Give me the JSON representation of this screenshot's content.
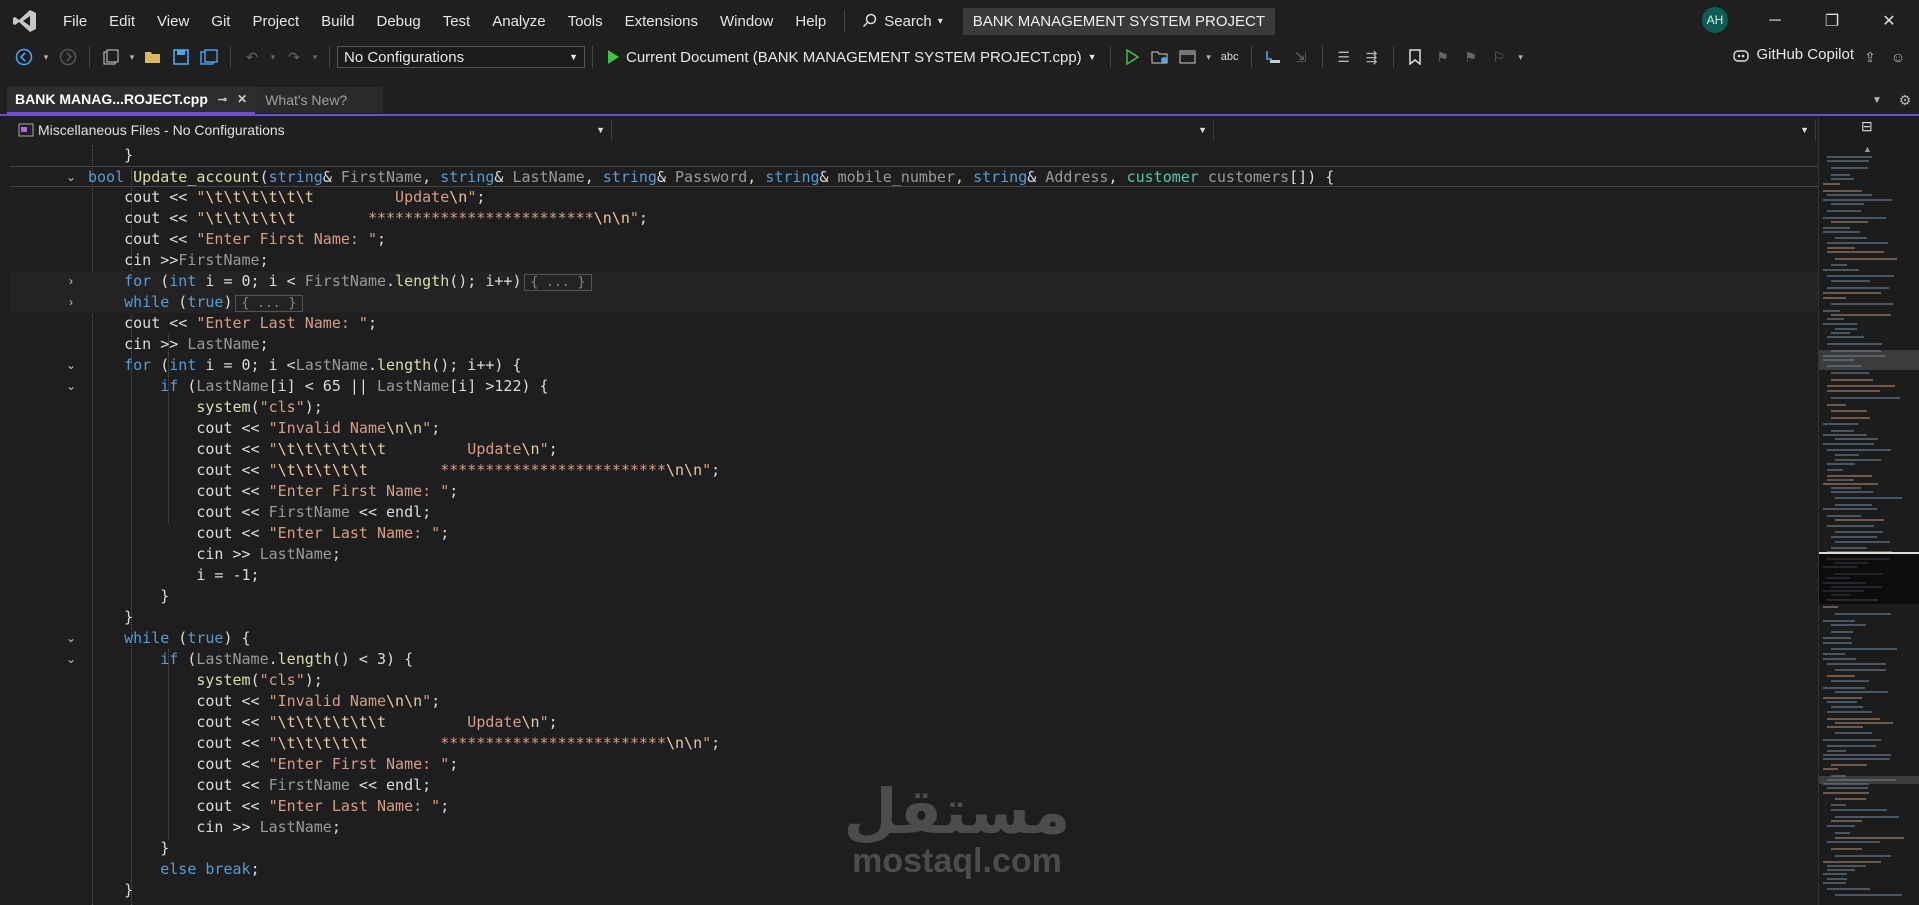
{
  "menu": [
    "File",
    "Edit",
    "View",
    "Git",
    "Project",
    "Build",
    "Debug",
    "Test",
    "Analyze",
    "Tools",
    "Extensions",
    "Window",
    "Help"
  ],
  "search_label": "Search",
  "window_title": "BANK MANAGEMENT SYSTEM PROJECT",
  "avatar_initials": "AH",
  "toolbar": {
    "configuration": "No Configurations",
    "run_target": "Current Document (BANK MANAGEMENT SYSTEM PROJECT.cpp)",
    "copilot_label": "GitHub Copilot"
  },
  "tabs": {
    "active": "BANK MANAG...ROJECT.cpp",
    "inactive": "What's New?"
  },
  "navbar": {
    "scope": "Miscellaneous Files - No Configurations",
    "middle": "",
    "right": ""
  },
  "code_lines": [
    "    }",
    "bool Update_account(string& FirstName, string& LastName, string& Password, string& mobile_number, string& Address, customer customers[]) {",
    "    cout << \"\\t\\t\\t\\t\\t\\t         Update\\n\";",
    "    cout << \"\\t\\t\\t\\t\\t        *************************\\n\\n\";",
    "    cout << \"Enter First Name: \";",
    "    cin >>FirstName;",
    "    for (int i = 0; i < FirstName.length(); i++)",
    "    while (true)",
    "    cout << \"Enter Last Name: \";",
    "    cin >> LastName;",
    "    for (int i = 0; i <LastName.length(); i++) {",
    "        if (LastName[i] < 65 || LastName[i] >122) {",
    "            system(\"cls\");",
    "            cout << \"Invalid Name\\n\\n\";",
    "            cout << \"\\t\\t\\t\\t\\t\\t         Update\\n\";",
    "            cout << \"\\t\\t\\t\\t\\t        *************************\\n\\n\";",
    "            cout << \"Enter First Name: \";",
    "            cout << FirstName << endl;",
    "            cout << \"Enter Last Name: \";",
    "            cin >> LastName;",
    "            i = -1;",
    "        }",
    "    }",
    "    while (true) {",
    "        if (LastName.length() < 3) {",
    "            system(\"cls\");",
    "            cout << \"Invalid Name\\n\\n\";",
    "            cout << \"\\t\\t\\t\\t\\t\\t         Update\\n\";",
    "            cout << \"\\t\\t\\t\\t\\t        *************************\\n\\n\";",
    "            cout << \"Enter First Name: \";",
    "            cout << FirstName << endl;",
    "            cout << \"Enter Last Name: \";",
    "            cin >> LastName;",
    "        }",
    "        else break;",
    "    }"
  ],
  "collapsed_block": "{ ... }",
  "watermark": {
    "arabic": "مستقل",
    "latin": "mostaql.com"
  },
  "colors": {
    "keyword": "#569cd6",
    "function": "#dcdcaa",
    "string": "#d69d85",
    "type": "#4ec9b0",
    "accent": "#6e4fcf"
  }
}
